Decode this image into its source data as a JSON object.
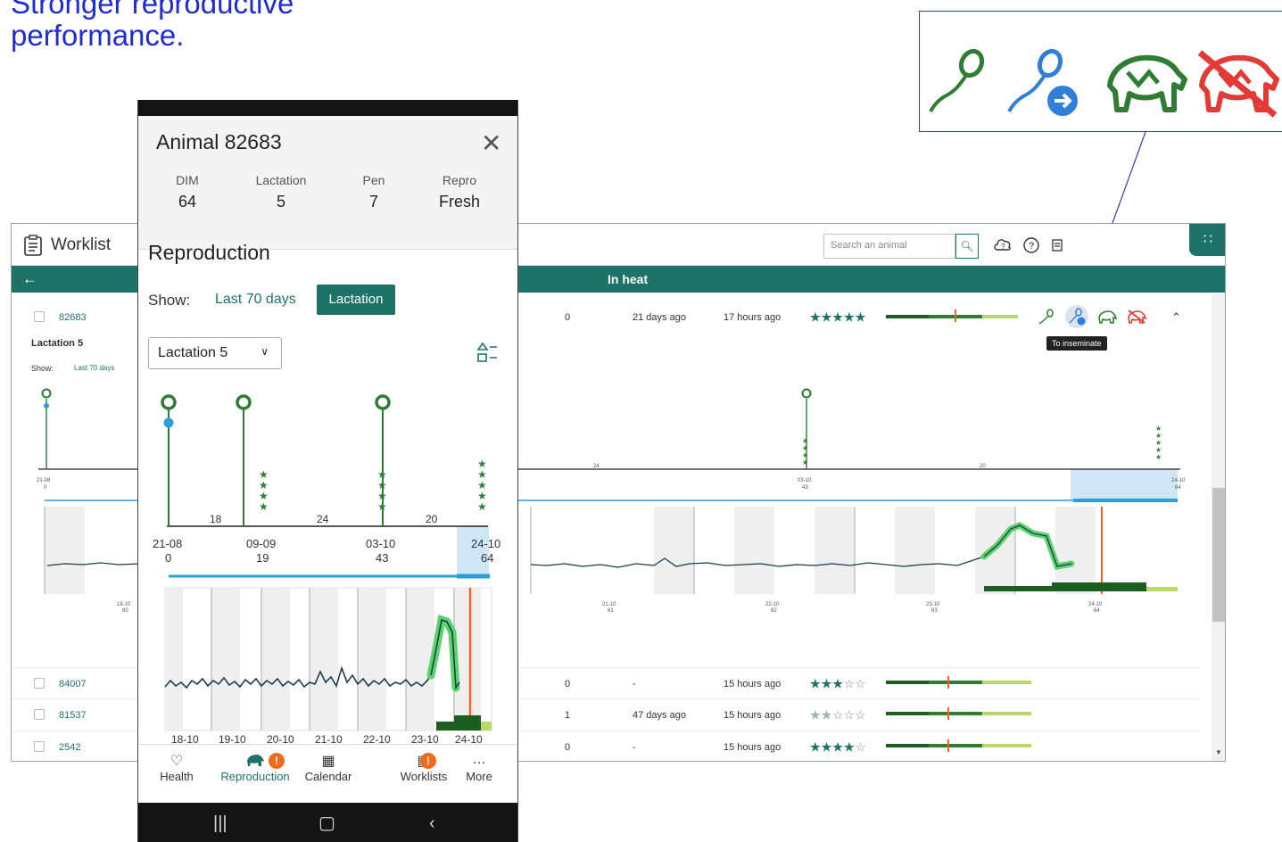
{
  "headline": {
    "line1": "Stronger reproductive",
    "line2": "performance."
  },
  "desktop": {
    "title": "Worklist",
    "search_placeholder": "Search an animal",
    "view_title": "In heat",
    "tooltip": "To inseminate",
    "expanded": {
      "lactation_label": "Lactation 5",
      "show_label": "Show:",
      "last70_label": "Last 70 days",
      "timeline_ticks": [
        {
          "date": "21-08",
          "dim": "0"
        },
        {
          "date": "03-10",
          "dim": "43"
        },
        {
          "date": "24-10",
          "dim": "64"
        }
      ],
      "gap_labels": [
        "24",
        "20"
      ],
      "activity_ticks": [
        {
          "date": "18-10",
          "dim": "60"
        },
        {
          "date": "21-10",
          "dim": "61"
        },
        {
          "date": "22-10",
          "dim": "62"
        },
        {
          "date": "23-10",
          "dim": "63"
        },
        {
          "date": "24-10",
          "dim": "64"
        }
      ]
    },
    "rows": [
      {
        "id": "82683",
        "col1": "0",
        "last_heat": "21 days ago",
        "updated": "17 hours ago",
        "stars": 5
      },
      {
        "id": "84007",
        "col1": "0",
        "last_heat": "-",
        "updated": "15 hours ago",
        "stars": 3
      },
      {
        "id": "81537",
        "col1": "1",
        "last_heat": "47 days ago",
        "updated": "15 hours ago",
        "stars": 2
      },
      {
        "id": "2542",
        "col1": "0",
        "last_heat": "-",
        "updated": "15 hours ago",
        "stars": 4
      }
    ]
  },
  "phone": {
    "animal_title": "Animal 82683",
    "stats": [
      {
        "label": "DIM",
        "value": "64"
      },
      {
        "label": "Lactation",
        "value": "5"
      },
      {
        "label": "Pen",
        "value": "7"
      },
      {
        "label": "Repro",
        "value": "Fresh"
      }
    ],
    "section_title": "Reproduction",
    "show_label": "Show:",
    "show_options": [
      "Last 70 days",
      "Lactation"
    ],
    "show_selected": "Lactation",
    "lactation_select": "Lactation 5",
    "timeline_ticks": [
      {
        "date": "21-08",
        "dim": "0"
      },
      {
        "date": "09-09",
        "dim": "19"
      },
      {
        "date": "03-10",
        "dim": "43"
      },
      {
        "date": "24-10",
        "dim": "64"
      }
    ],
    "gap_labels": [
      "18",
      "24",
      "20"
    ],
    "activity_ticks": [
      "18-10",
      "19-10",
      "20-10",
      "21-10",
      "22-10",
      "23-10",
      "24-10"
    ],
    "nav": [
      {
        "label": "Health",
        "icon": "heart-pulse-icon"
      },
      {
        "label": "Reproduction",
        "icon": "cow-icon",
        "badge": "!"
      },
      {
        "label": "Calendar",
        "icon": "calendar-icon"
      },
      {
        "label": "Worklists",
        "icon": "clipboard-icon",
        "badge": "!"
      },
      {
        "label": "More",
        "icon": "more-icon"
      }
    ]
  },
  "colors": {
    "brand_green": "#1e7368",
    "headline_blue": "#1f2bd6",
    "insem_blue": "#2f7fd8",
    "pregnant_green": "#2e7d32",
    "not_pregnant_red": "#e53935",
    "heat_orange": "#f0642c"
  }
}
